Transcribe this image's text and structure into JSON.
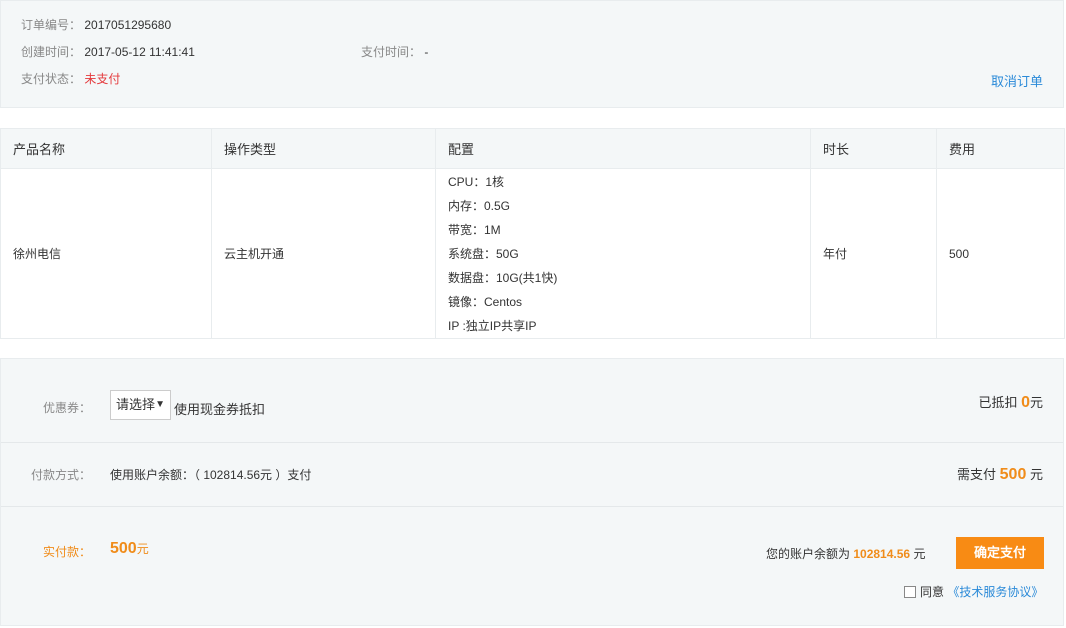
{
  "order": {
    "number_label": "订单编号：",
    "number": "2017051295680",
    "created_label": "创建时间：",
    "created": "2017-05-12 11:41:41",
    "paid_label": "支付时间：",
    "paid": "-",
    "status_label": "支付状态：",
    "status": "未支付",
    "cancel_label": "取消订单"
  },
  "table": {
    "headers": [
      "产品名称",
      "操作类型",
      "配置",
      "时长",
      "费用"
    ],
    "row": {
      "product": "徐州电信",
      "operation": "云主机开通",
      "config": [
        "CPU：1核",
        "内存：0.5G",
        "带宽：1M",
        "系统盘：50G",
        "数据盘：10G(共1快)",
        "镜像：Centos",
        "IP :独立IP共享IP"
      ],
      "duration": "年付",
      "fee": "500"
    }
  },
  "payment": {
    "coupon_label": "优惠券：",
    "coupon_select": "请选择",
    "coupon_hint": "使用现金券抵扣",
    "deducted_label": "已抵扣",
    "deducted_value": "0",
    "deducted_unit": "元",
    "method_label": "付款方式：",
    "method_text": "使用账户余额：（ 102814.56元 ）支付",
    "need_label": "需支付",
    "need_value": "500",
    "need_unit": "元",
    "actual_label": "实付款：",
    "actual_value": "500",
    "actual_unit": "元",
    "balance_label": "您的账户余额为",
    "balance_value": "102814.56",
    "balance_unit": "元",
    "confirm_label": "确定支付",
    "agree_label": "同意",
    "agree_link": "《技术服务协议》"
  },
  "colors": {
    "accent_orange": "#f88b14",
    "link_blue": "#2a8ad8",
    "status_red": "#e4393c",
    "panel_bg": "#f4f7f8"
  }
}
